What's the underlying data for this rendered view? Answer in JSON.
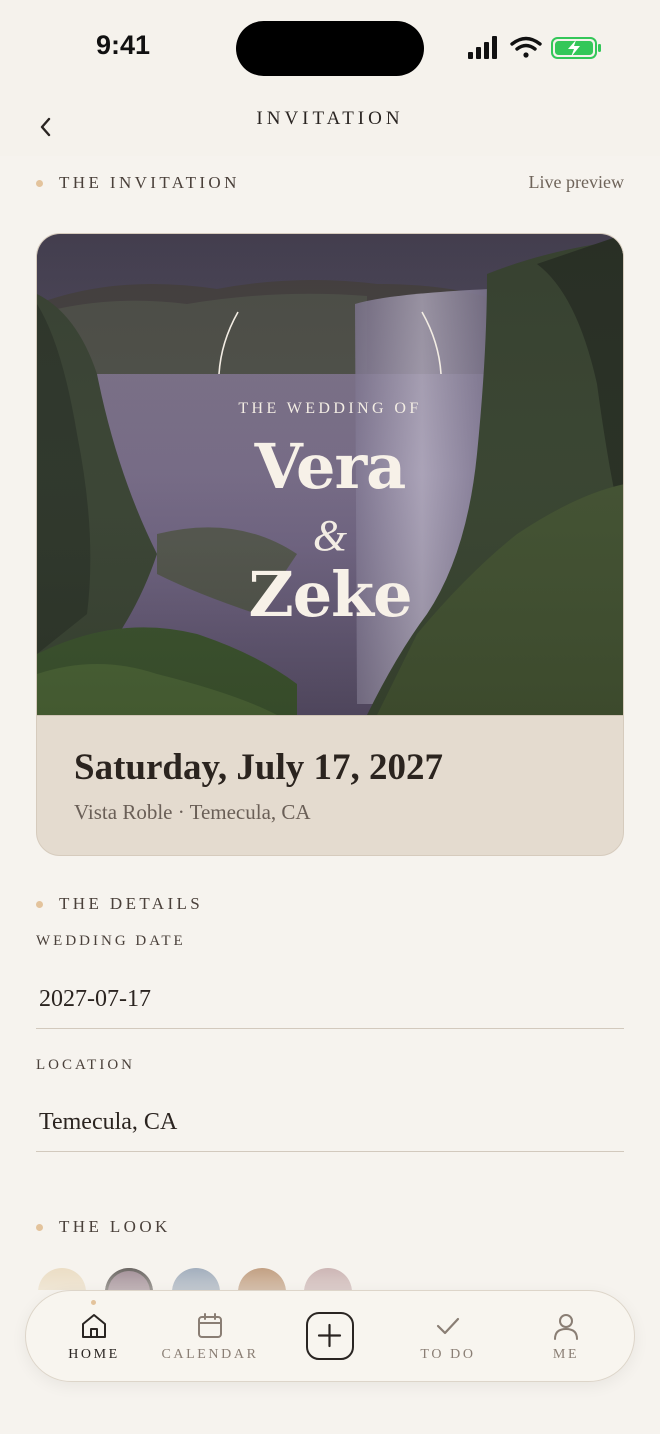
{
  "status": {
    "time": "9:41"
  },
  "header": {
    "title": "INVITATION"
  },
  "invitation_section": {
    "label": "THE INVITATION",
    "live_preview": "Live preview"
  },
  "card": {
    "eyebrow": "THE WEDDING OF",
    "name_1": "Vera",
    "ampersand": "&",
    "name_2": "Zeke",
    "date": "Saturday, July 17, 2027",
    "venue": "Vista Roble · Temecula, CA"
  },
  "details_section": {
    "label": "THE DETAILS"
  },
  "fields": {
    "date_label": "WEDDING DATE",
    "date_value": "2027-07-17",
    "location_label": "LOCATION",
    "location_value": "Temecula, CA"
  },
  "look_section": {
    "label": "THE LOOK"
  },
  "swatch_colors": [
    "#e6d3b1",
    "#7a5f6e",
    "#7b8ea6",
    "#a9784f",
    "#b9999a"
  ],
  "tabs": [
    {
      "label": "HOME",
      "icon": "home-icon",
      "active": true
    },
    {
      "label": "CALENDAR",
      "icon": "calendar-icon",
      "active": false
    },
    {
      "label": "",
      "icon": "plus-icon",
      "active": false
    },
    {
      "label": "TO DO",
      "icon": "check-icon",
      "active": false
    },
    {
      "label": "ME",
      "icon": "person-icon",
      "active": false
    }
  ],
  "colors": {
    "background": "#f6f3ee",
    "accent_dot": "#e3c39c",
    "ink": "#2a2522"
  }
}
